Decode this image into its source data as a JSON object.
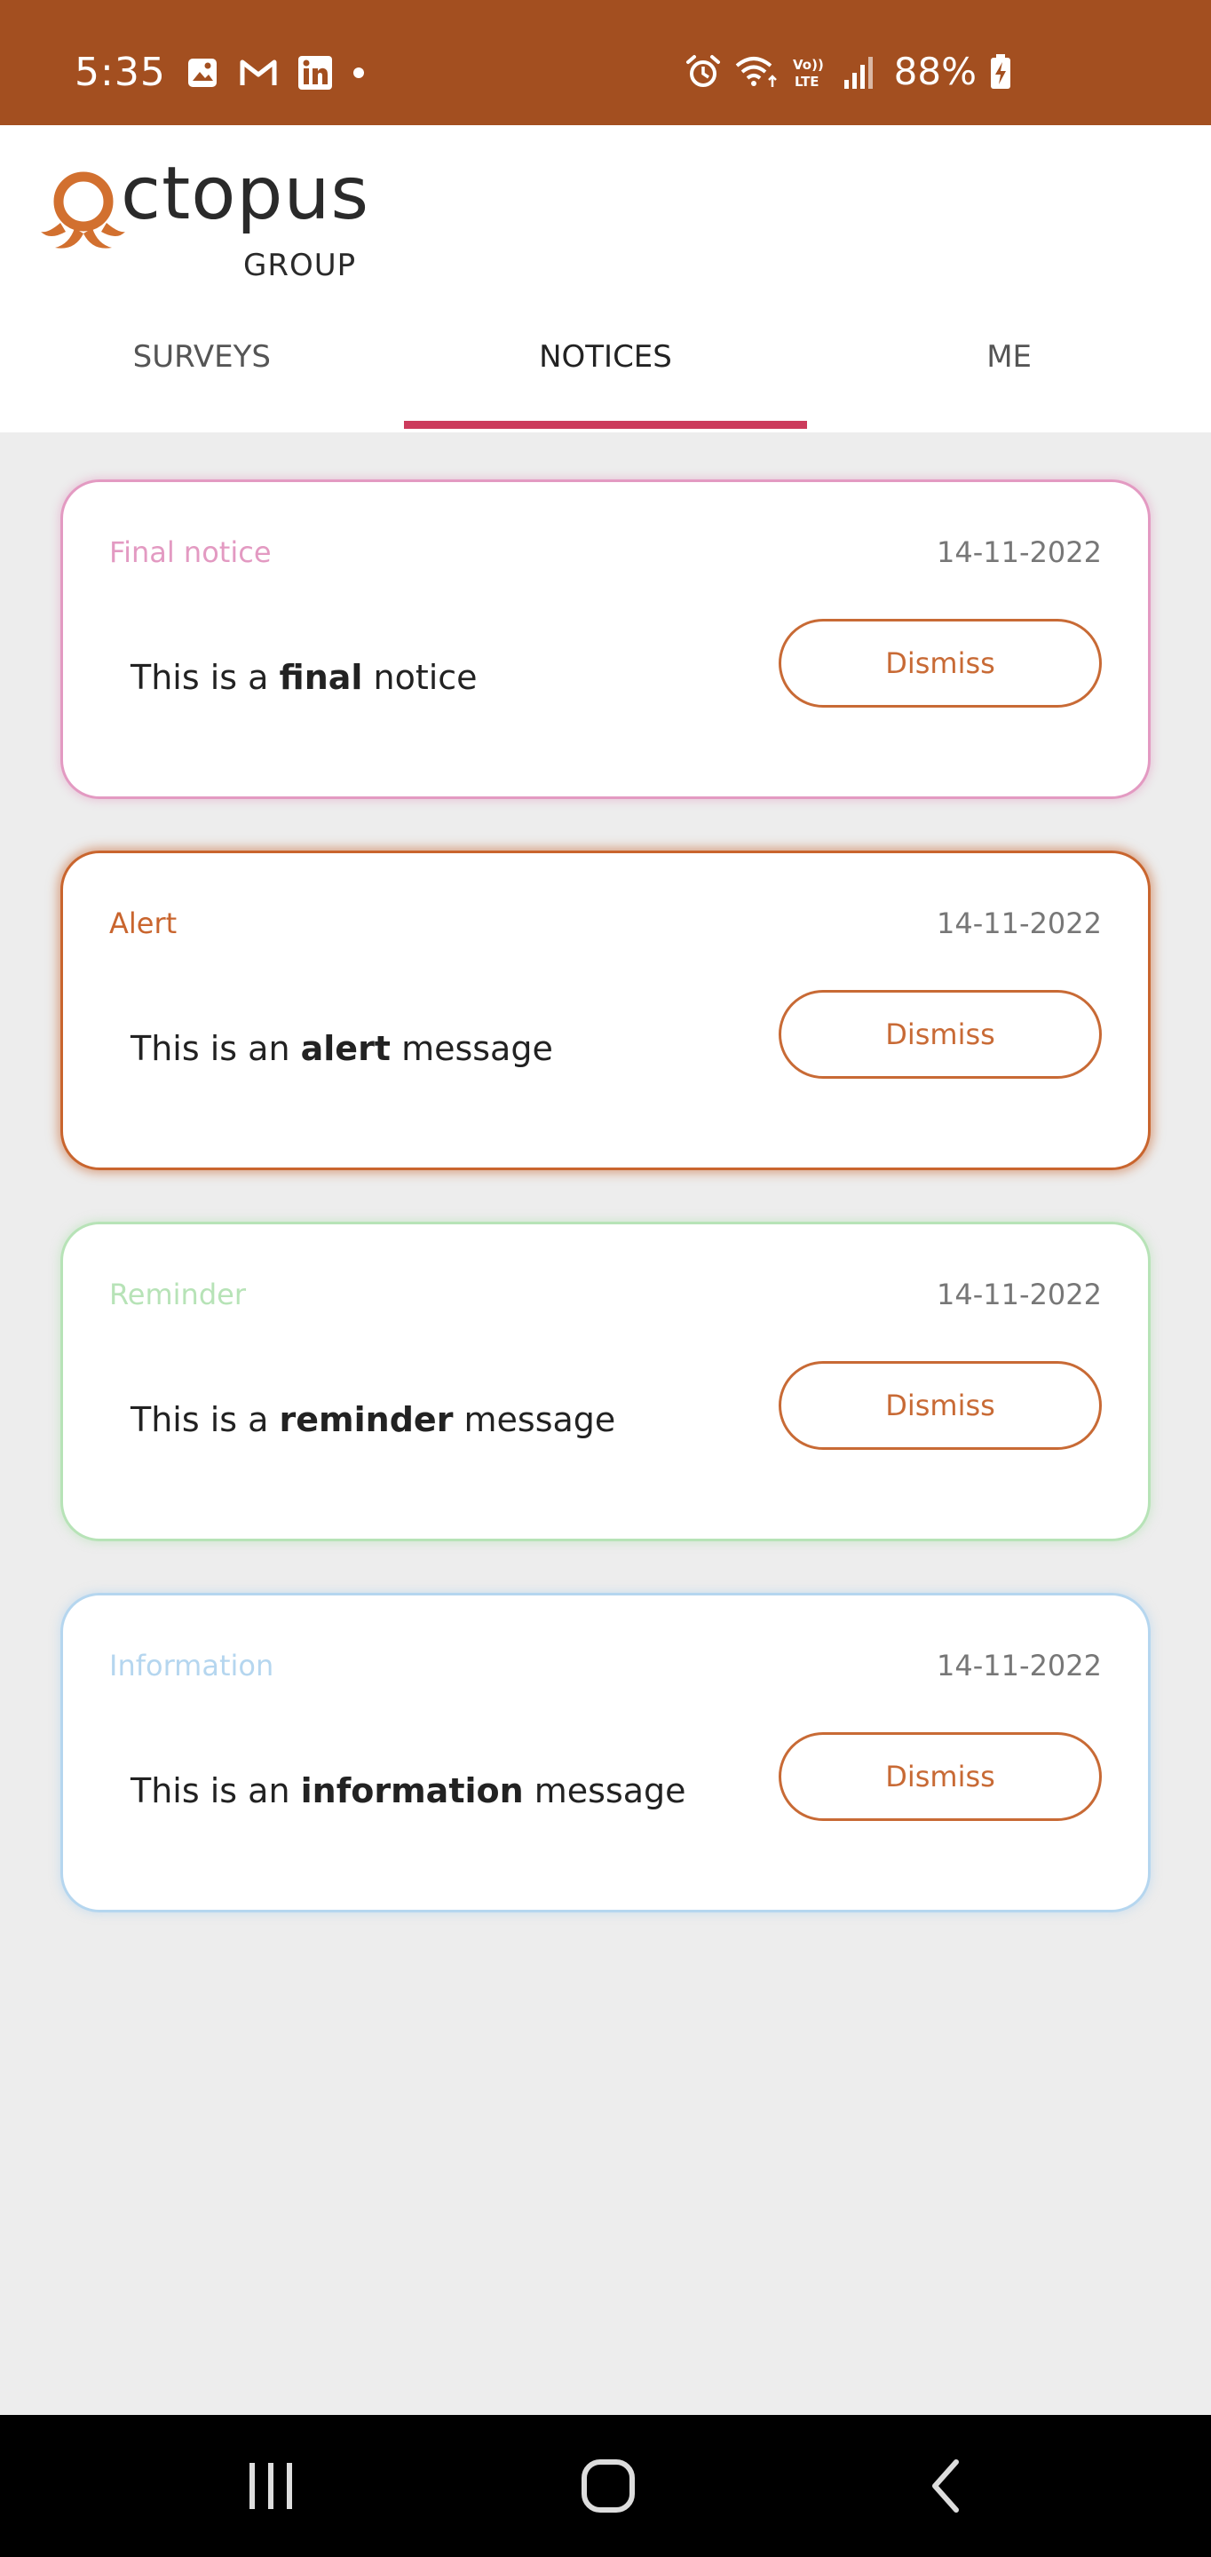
{
  "status_bar": {
    "time": "5:35",
    "left_icons": [
      "image-icon",
      "gmail-icon",
      "linkedin-icon",
      "dot-icon"
    ],
    "right_icons": [
      "alarm-icon",
      "wifi-icon",
      "volte-icon",
      "signal-icon"
    ],
    "battery_text": "88%"
  },
  "header": {
    "logo_text": "ctopus",
    "logo_subtext": "GROUP",
    "tabs": [
      {
        "label": "SURVEYS",
        "active": false
      },
      {
        "label": "NOTICES",
        "active": true
      },
      {
        "label": "ME",
        "active": false
      }
    ]
  },
  "notices": [
    {
      "type": "Final notice",
      "date": "14-11-2022",
      "message_prefix": "This is a ",
      "message_bold": "final",
      "message_suffix": " notice",
      "dismiss_label": "Dismiss",
      "color": "#e39ac2"
    },
    {
      "type": "Alert",
      "date": "14-11-2022",
      "message_prefix": "This is an ",
      "message_bold": "alert",
      "message_suffix": " message",
      "dismiss_label": "Dismiss",
      "color": "#c9652e"
    },
    {
      "type": "Reminder",
      "date": "14-11-2022",
      "message_prefix": "This is a ",
      "message_bold": "reminder",
      "message_suffix": " message",
      "dismiss_label": "Dismiss",
      "color": "#b7e3b7"
    },
    {
      "type": "Information",
      "date": "14-11-2022",
      "message_prefix": "This is an ",
      "message_bold": "information",
      "message_suffix": " message",
      "dismiss_label": "Dismiss",
      "color": "#b5d6ef"
    }
  ],
  "colors": {
    "status_bar": "#a34f20",
    "tab_indicator": "#cc3b5c",
    "dismiss_accent": "#c86a35",
    "logo_accent": "#d2702f"
  },
  "nav_bar": {
    "buttons": [
      "recent-apps-icon",
      "home-icon",
      "back-icon"
    ]
  }
}
